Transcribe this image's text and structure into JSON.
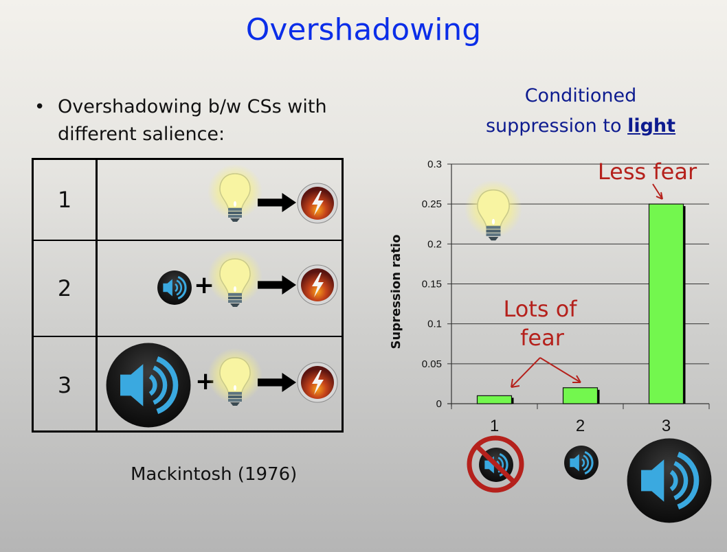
{
  "slide": {
    "title": "Overshadowing",
    "bullet": "Overshadowing b/w CSs with different salience:",
    "bullet_marker": "•",
    "citation": "Mackintosh (1976)"
  },
  "design_table": {
    "rows": [
      {
        "group": "1",
        "stimuli": [
          "light-bulb-icon"
        ],
        "outcome": "shock-icon",
        "operator": "+"
      },
      {
        "group": "2",
        "stimuli": [
          "small-tone-speaker-icon",
          "light-bulb-icon"
        ],
        "outcome": "shock-icon",
        "operator": "+"
      },
      {
        "group": "3",
        "stimuli": [
          "large-tone-speaker-icon",
          "light-bulb-icon"
        ],
        "outcome": "shock-icon",
        "operator": "+"
      }
    ]
  },
  "chart_title": {
    "line1": "Conditioned",
    "line2_prefix": "suppression to ",
    "line2_emphasis": "light"
  },
  "annotations": {
    "less_fear": "Less fear",
    "lots_of_fear_line1": "Lots of",
    "lots_of_fear_line2": "fear"
  },
  "colors": {
    "title": "#0b2ee8",
    "chart_title": "#0d1b8f",
    "bar_fill": "#73f74e",
    "annotation": "#b5211c",
    "speaker_blue": "#3aa9e0"
  },
  "chart_data": {
    "type": "bar",
    "title": "Conditioned suppression to light",
    "xlabel": "",
    "ylabel": "Supression ratio",
    "categories": [
      "1",
      "2",
      "3"
    ],
    "values": [
      0.01,
      0.02,
      0.25
    ],
    "ylim": [
      0,
      0.3
    ],
    "yticks": [
      0,
      0.05,
      0.1,
      0.15,
      0.2,
      0.25,
      0.3
    ],
    "ytick_labels": [
      "0",
      "0.05",
      "0.1",
      "0.15",
      "0.2",
      "0.25",
      "0.3"
    ],
    "grid": true,
    "category_icons": [
      "crossed-out-small-tone-icon",
      "small-tone-icon",
      "large-tone-icon"
    ]
  }
}
